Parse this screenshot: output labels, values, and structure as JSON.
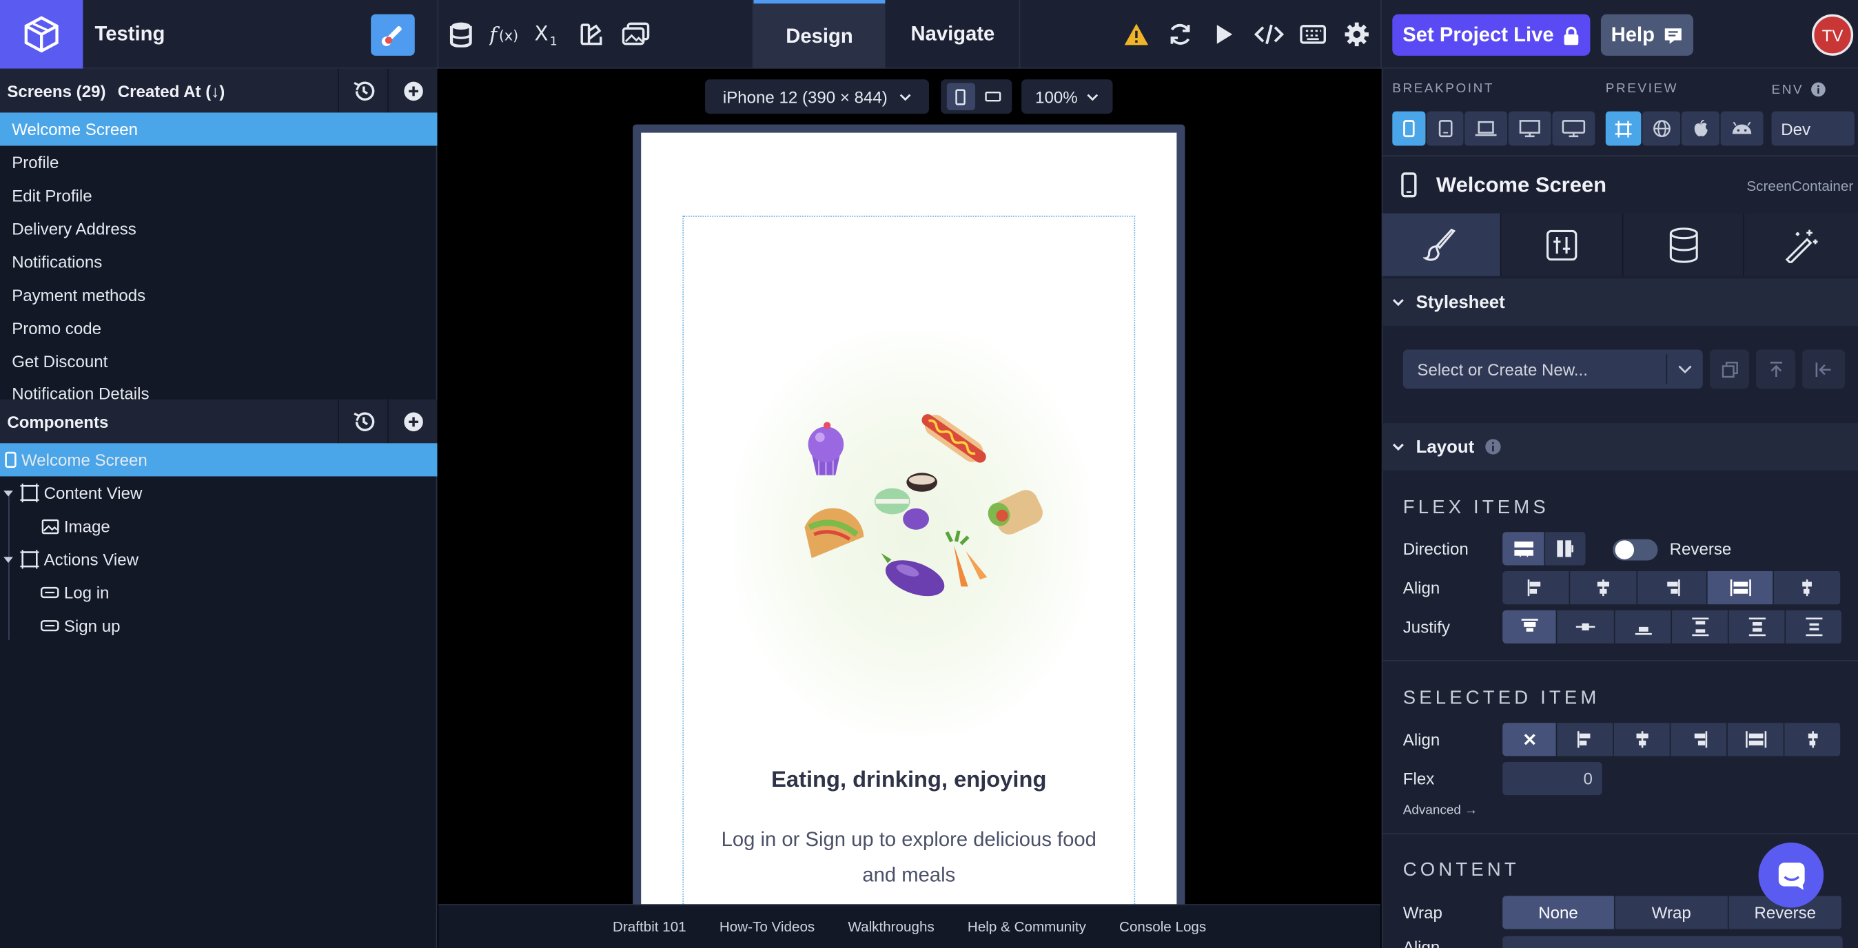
{
  "project": {
    "name": "Testing"
  },
  "topbar": {
    "tabs": [
      "Design",
      "Navigate"
    ],
    "set_live": "Set Project Live",
    "help": "Help",
    "avatar_initials": "TV",
    "accent": "#5a4af4"
  },
  "screens": {
    "header": "Screens (29)",
    "sort_label": "Created At (↓)",
    "items": [
      "Welcome Screen",
      "Profile",
      "Edit Profile",
      "Delivery Address",
      "Notifications",
      "Payment methods",
      "Promo code",
      "Get Discount",
      "Notification Details"
    ]
  },
  "components": {
    "header": "Components",
    "tree": [
      "Welcome Screen",
      "Content View",
      "Image",
      "Actions View",
      "Log in",
      "Sign up"
    ]
  },
  "canvas": {
    "device": "iPhone 12 (390 × 844)",
    "zoom": "100%",
    "headline": "Eating, drinking, enjoying",
    "subtext": "Log in or Sign up to explore delicious food and meals"
  },
  "footer": {
    "links": [
      "Draftbit 101",
      "How-To Videos",
      "Walkthroughs",
      "Help & Community",
      "Console Logs"
    ]
  },
  "inspector": {
    "breakpoint_label": "BREAKPOINT",
    "preview_label": "PREVIEW",
    "env_label": "ENV",
    "env_value": "Dev",
    "component_title": "Welcome Screen",
    "component_type": "ScreenContainer",
    "stylesheet_title": "Stylesheet",
    "stylesheet_placeholder": "Select or Create New...",
    "layout_title": "Layout",
    "flex_items": "FLEX ITEMS",
    "direction": "Direction",
    "reverse": "Reverse",
    "align": "Align",
    "justify": "Justify",
    "selected_item": "SELECTED ITEM",
    "selected_align": "Align",
    "flex": "Flex",
    "flex_value": "0",
    "advanced": "Advanced →",
    "content": "CONTENT",
    "wrap": "Wrap",
    "wrap_options": [
      "None",
      "Wrap",
      "Reverse"
    ],
    "align_cut": "Align"
  }
}
